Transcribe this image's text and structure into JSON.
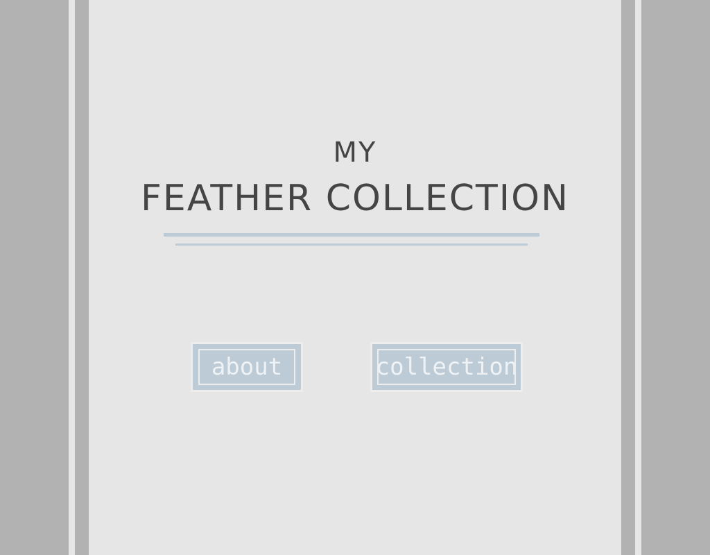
{
  "title": {
    "line1": "MY",
    "line2": "FEATHER COLLECTION"
  },
  "nav": {
    "about_label": "about",
    "collection_label": "collection"
  },
  "colors": {
    "background_outer": "#b2b2b2",
    "panel": "#e6e6e6",
    "accent_blue": "#bccbd6",
    "title_text": "#444444",
    "button_text": "#eef2f5"
  }
}
